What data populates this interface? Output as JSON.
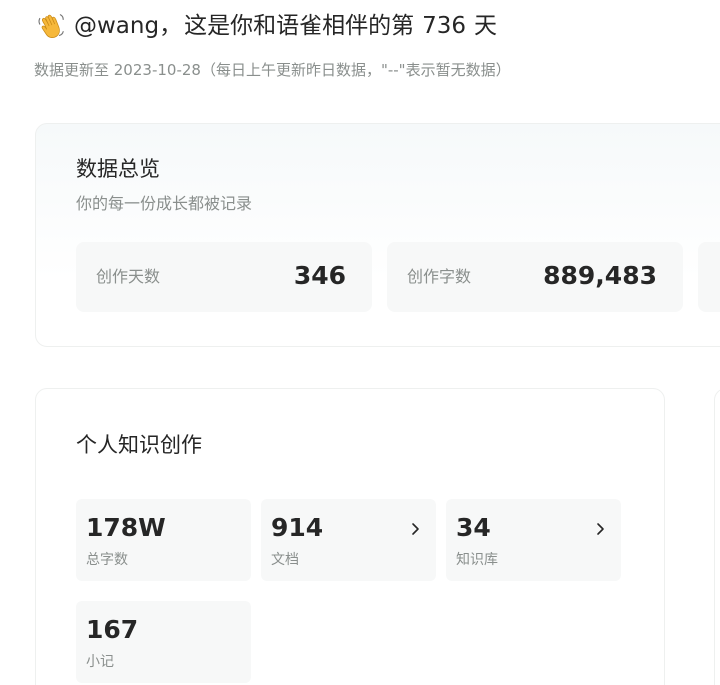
{
  "header": {
    "wave_icon": "waving-hand-icon",
    "username": "@wang",
    "separator": "，",
    "greeting_prefix": "这是你和语雀相伴的第",
    "days": "736",
    "greeting_suffix": "天",
    "update_note": "数据更新至 2023-10-28（每日上午更新昨日数据，\"--\"表示暂无数据）"
  },
  "overview": {
    "title": "数据总览",
    "subtitle": "你的每一份成长都被记录",
    "stats": [
      {
        "label": "创作天数",
        "value": "346"
      },
      {
        "label": "创作字数",
        "value": "889,483"
      },
      {
        "label": "",
        "value": ""
      }
    ]
  },
  "knowledge": {
    "title": "个人知识创作",
    "tiles": [
      {
        "value": "178W",
        "label": "总字数"
      },
      {
        "value": "914",
        "label": "文档",
        "icon": "chevron-right-icon"
      },
      {
        "value": "34",
        "label": "知识库",
        "icon": "chevron-right-icon"
      },
      {
        "value": "167",
        "label": "小记"
      }
    ]
  },
  "colors": {
    "text_primary": "#262626",
    "text_secondary": "#8a8f8d",
    "tile_bg": "#f7f8f8",
    "card_border": "#eef0ef"
  }
}
